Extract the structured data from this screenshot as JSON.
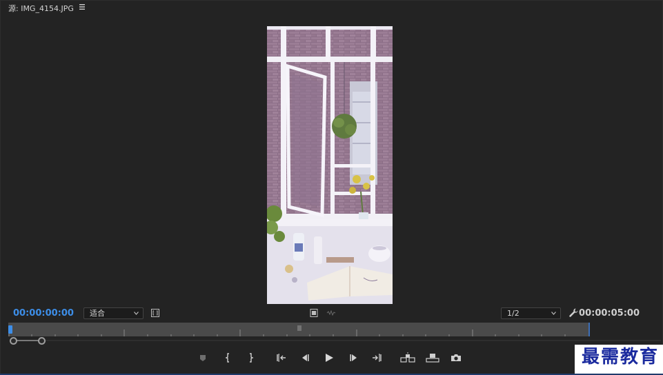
{
  "panel": {
    "title": "源: IMG_4154.JPG",
    "menu_icon": "hamburger-menu-icon"
  },
  "controls": {
    "current_timecode": "00:00:00:00",
    "zoom_select_value": "适合",
    "resolution_select_value": "1/2",
    "duration_timecode": "00:00:05:00",
    "settings_icon": "wrench-icon"
  },
  "transport": {
    "buttons": [
      {
        "name": "add-marker-button",
        "icon": "marker-icon"
      },
      {
        "name": "mark-in-button",
        "icon": "mark-in-icon"
      },
      {
        "name": "mark-out-button",
        "icon": "mark-out-icon"
      },
      {
        "name": "go-to-in-button",
        "icon": "go-to-in-icon"
      },
      {
        "name": "step-back-button",
        "icon": "step-back-icon"
      },
      {
        "name": "play-button",
        "icon": "play-icon"
      },
      {
        "name": "step-forward-button",
        "icon": "step-forward-icon"
      },
      {
        "name": "go-to-out-button",
        "icon": "go-to-out-icon"
      },
      {
        "name": "insert-button",
        "icon": "insert-icon"
      },
      {
        "name": "overwrite-button",
        "icon": "overwrite-icon"
      },
      {
        "name": "export-frame-button",
        "icon": "camera-icon"
      }
    ]
  },
  "watermark": {
    "text": "最需教育"
  },
  "colors": {
    "accent": "#3d8ee8",
    "panel_bg": "#232323",
    "timeline_bg": "#4a4a4a",
    "watermark": "#1a2a9e"
  }
}
